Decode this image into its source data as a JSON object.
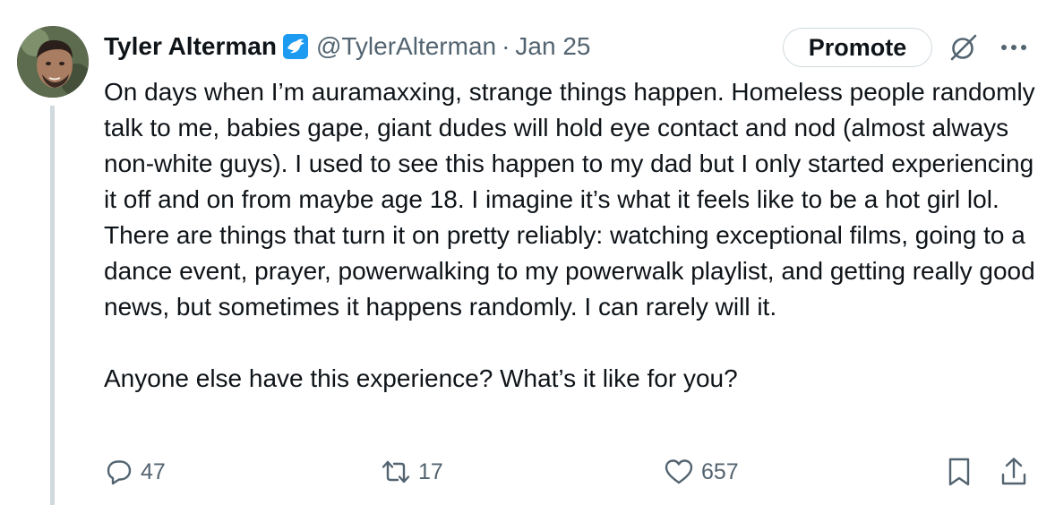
{
  "author": {
    "name": "Tyler Alterman",
    "handle": "@TylerAlterman",
    "separator": "·",
    "date": "Jan 25",
    "verified_icon": "verified-badge-icon"
  },
  "header_actions": {
    "promote_label": "Promote",
    "grok_icon": "grok-icon",
    "more_icon": "more-icon"
  },
  "tweet": {
    "paragraph_1": "On days when I’m auramaxxing, strange things happen. Homeless people randomly talk to me, babies gape, giant dudes will hold eye contact and nod (almost always non-white guys). I used to see this happen to my dad but I only started experiencing it off and on from maybe age 18. I imagine it’s what it feels like to be a hot girl lol. There are things that turn it on pretty reliably: watching exceptional films, going to a dance event, prayer, powerwalking to my powerwalk playlist,  and getting really good news, but sometimes it happens randomly. I can rarely will it.",
    "paragraph_2": "Anyone else have this experience? What’s it like for you?"
  },
  "metrics": {
    "replies": "47",
    "reposts": "17",
    "likes": "657"
  },
  "colors": {
    "text": "#0f1419",
    "secondary": "#536471",
    "verified_blue": "#1d9bf0",
    "border": "#cfd9de"
  }
}
